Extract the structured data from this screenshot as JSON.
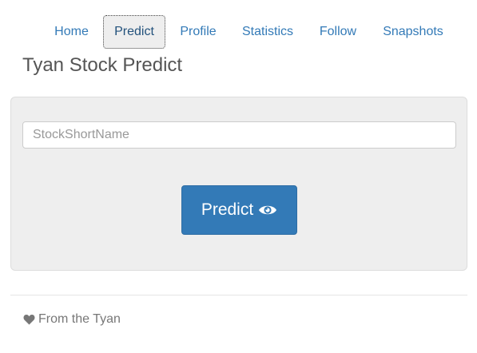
{
  "nav": {
    "items": [
      {
        "label": "Home"
      },
      {
        "label": "Predict",
        "active": true
      },
      {
        "label": "Profile"
      },
      {
        "label": "Statistics"
      },
      {
        "label": "Follow"
      },
      {
        "label": "Snapshots"
      }
    ]
  },
  "header": {
    "title": "Tyan Stock Predict"
  },
  "form": {
    "input_placeholder": "StockShortName",
    "input_value": "",
    "button_label": "Predict",
    "button_icon": "eye-icon"
  },
  "footer": {
    "icon": "heart-icon",
    "text": "From the Tyan"
  },
  "colors": {
    "link": "#337ab7",
    "primary_button": "#337ab7",
    "panel_background": "#eeeeee"
  }
}
